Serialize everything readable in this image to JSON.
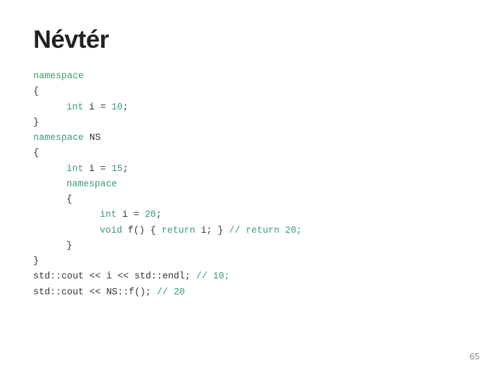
{
  "title": "Névtér",
  "code": {
    "lines": [
      {
        "indent": 0,
        "tokens": [
          {
            "t": "namespace",
            "c": "kw"
          }
        ]
      },
      {
        "indent": 0,
        "tokens": [
          {
            "t": "{",
            "c": "plain"
          }
        ]
      },
      {
        "indent": 1,
        "tokens": [
          {
            "t": "int",
            "c": "kw"
          },
          {
            "t": " i = ",
            "c": "plain"
          },
          {
            "t": "10",
            "c": "num"
          },
          {
            "t": ";",
            "c": "plain"
          }
        ]
      },
      {
        "indent": 0,
        "tokens": [
          {
            "t": "}",
            "c": "plain"
          }
        ]
      },
      {
        "indent": 0,
        "tokens": [
          {
            "t": "namespace",
            "c": "kw"
          },
          {
            "t": " NS",
            "c": "plain"
          }
        ]
      },
      {
        "indent": 0,
        "tokens": [
          {
            "t": "{",
            "c": "plain"
          }
        ]
      },
      {
        "indent": 1,
        "tokens": [
          {
            "t": "int",
            "c": "kw"
          },
          {
            "t": " i = ",
            "c": "plain"
          },
          {
            "t": "15",
            "c": "num"
          },
          {
            "t": ";",
            "c": "plain"
          }
        ]
      },
      {
        "indent": 1,
        "tokens": [
          {
            "t": "namespace",
            "c": "kw"
          }
        ]
      },
      {
        "indent": 1,
        "tokens": [
          {
            "t": "{",
            "c": "plain"
          }
        ]
      },
      {
        "indent": 2,
        "tokens": [
          {
            "t": "int",
            "c": "kw"
          },
          {
            "t": " i = ",
            "c": "plain"
          },
          {
            "t": "20",
            "c": "num"
          },
          {
            "t": ";",
            "c": "plain"
          }
        ]
      },
      {
        "indent": 2,
        "tokens": [
          {
            "t": "void",
            "c": "kw"
          },
          {
            "t": " f() { ",
            "c": "plain"
          },
          {
            "t": "return",
            "c": "kw"
          },
          {
            "t": " i; } ",
            "c": "plain"
          },
          {
            "t": "// return 20;",
            "c": "comment"
          }
        ]
      },
      {
        "indent": 1,
        "tokens": [
          {
            "t": "}",
            "c": "plain"
          }
        ]
      },
      {
        "indent": 0,
        "tokens": [
          {
            "t": "}",
            "c": "plain"
          }
        ]
      },
      {
        "indent": 0,
        "tokens": [
          {
            "t": "std::cout",
            "c": "plain"
          },
          {
            "t": " << i << ",
            "c": "plain"
          },
          {
            "t": "std::endl;",
            "c": "plain"
          },
          {
            "t": " // 10;",
            "c": "comment"
          }
        ]
      },
      {
        "indent": 0,
        "tokens": [
          {
            "t": "std::cout",
            "c": "plain"
          },
          {
            "t": " << NS::f(); ",
            "c": "plain"
          },
          {
            "t": "// 20",
            "c": "comment"
          }
        ]
      }
    ]
  },
  "page_number": "65"
}
